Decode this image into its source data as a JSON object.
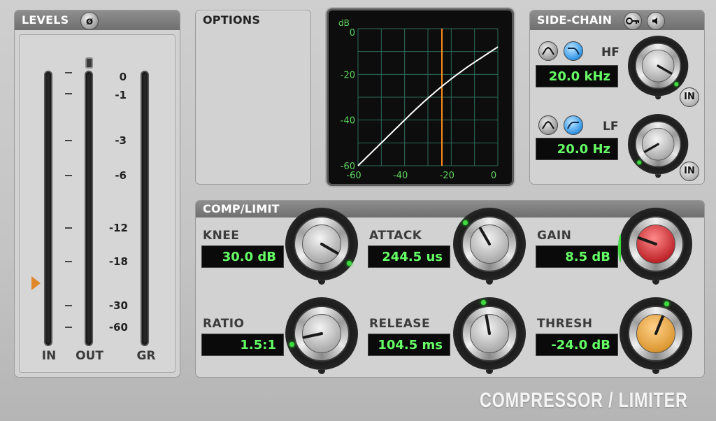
{
  "levels": {
    "title": "LEVELS",
    "phase_symbol": "ø",
    "scale": [
      "0",
      "-1",
      "-3",
      "-6",
      "-12",
      "-18",
      "-30",
      "-60"
    ],
    "meters": [
      {
        "label": "IN",
        "level": 0
      },
      {
        "label": "OUT",
        "level": 0
      },
      {
        "label": "GR",
        "level": 0
      }
    ]
  },
  "options": {
    "title": "OPTIONS"
  },
  "graph": {
    "unit": "dB",
    "y_ticks": [
      "0",
      "-20",
      "-40",
      "-60"
    ],
    "x_ticks": [
      "-60",
      "-40",
      "-20",
      "0"
    ],
    "threshold_db": -24,
    "ratio": 1.5,
    "knee_db": 30,
    "colors": {
      "curve": "#ffffff",
      "threshold": "#ff8c1a",
      "grid": "#2c6b5b",
      "text": "#5fd65f"
    }
  },
  "sidechain": {
    "title": "SIDE-CHAIN",
    "key_icon": "key-icon",
    "listen_icon": "speaker-icon",
    "hf": {
      "label": "HF",
      "value": "20.0 kHz",
      "in_label": "IN"
    },
    "lf": {
      "label": "LF",
      "value": "20.0 Hz",
      "in_label": "IN"
    }
  },
  "comp": {
    "title": "COMP/LIMIT",
    "params": {
      "knee": {
        "label": "KNEE",
        "value": "30.0 dB"
      },
      "attack": {
        "label": "ATTACK",
        "value": "244.5 us"
      },
      "gain": {
        "label": "GAIN",
        "value": "8.5 dB"
      },
      "ratio": {
        "label": "RATIO",
        "value": "1.5:1"
      },
      "release": {
        "label": "RELEASE",
        "value": "104.5 ms"
      },
      "thresh": {
        "label": "THRESH",
        "value": "-24.0 dB"
      }
    }
  },
  "brand": "COMPRESSOR / LIMITER"
}
